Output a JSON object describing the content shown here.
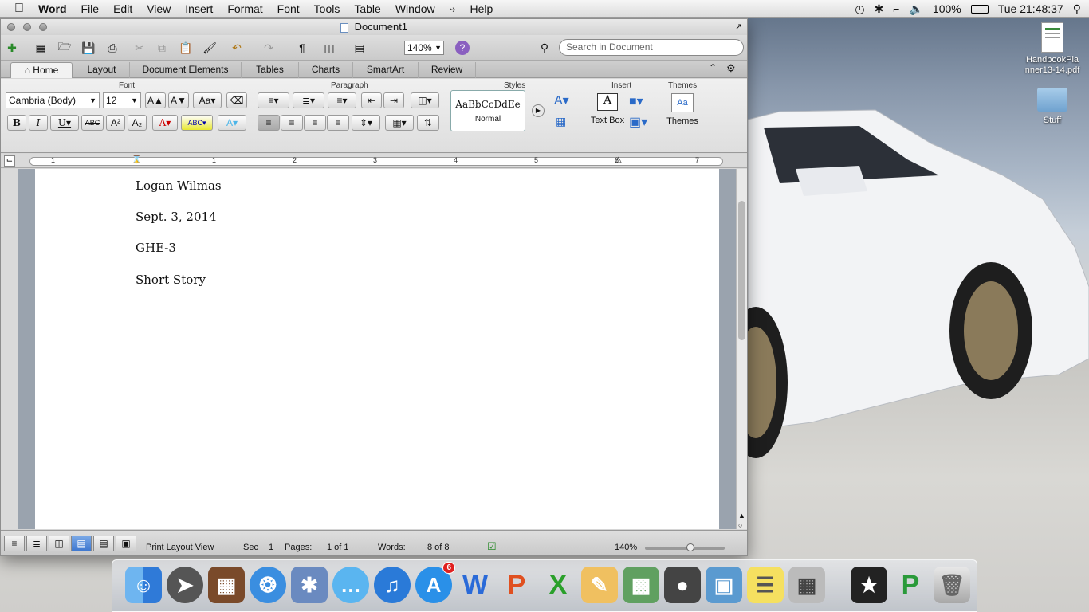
{
  "menubar": {
    "apple": "",
    "app": "Word",
    "items": [
      "File",
      "Edit",
      "View",
      "Insert",
      "Format",
      "Font",
      "Tools",
      "Table",
      "Window",
      "",
      "Help"
    ],
    "battery": "100%",
    "clock": "Tue 21:48:37"
  },
  "desktop": {
    "icons": [
      {
        "label": "HandbookPla nner13-14.pdf",
        "icon": "pdf-document-icon"
      },
      {
        "label": "Stuff",
        "icon": "folder-icon"
      }
    ]
  },
  "window": {
    "title": "Document1",
    "zoom": "140%",
    "search_placeholder": "Search in Document"
  },
  "tabs": [
    "Home",
    "Layout",
    "Document Elements",
    "Tables",
    "Charts",
    "SmartArt",
    "Review"
  ],
  "ribbon": {
    "groups": [
      "Font",
      "Paragraph",
      "Styles",
      "Insert",
      "Themes"
    ],
    "font_name": "Cambria (Body)",
    "font_size": "12",
    "style_preview": "AaBbCcDdEe",
    "style_name": "Normal",
    "textbox_label": "Text Box",
    "themes_label": "Themes",
    "themes_preview": "Aa"
  },
  "ruler": {
    "numbers": [
      "1",
      "1",
      "2",
      "3",
      "4",
      "5",
      "6",
      "7"
    ]
  },
  "document": {
    "lines": [
      "Logan Wilmas",
      "Sept. 3, 2014",
      "GHE-3",
      "Short Story"
    ]
  },
  "status": {
    "view": "Print Layout View",
    "sec_label": "Sec",
    "sec_value": "1",
    "pages_label": "Pages:",
    "pages_value": "1 of 1",
    "words_label": "Words:",
    "words_value": "8 of 8",
    "zoom": "140%"
  },
  "dock": {
    "badge": "6",
    "letters": {
      "word": "W",
      "powerpoint": "P",
      "excel": "X",
      "project": "P"
    }
  }
}
